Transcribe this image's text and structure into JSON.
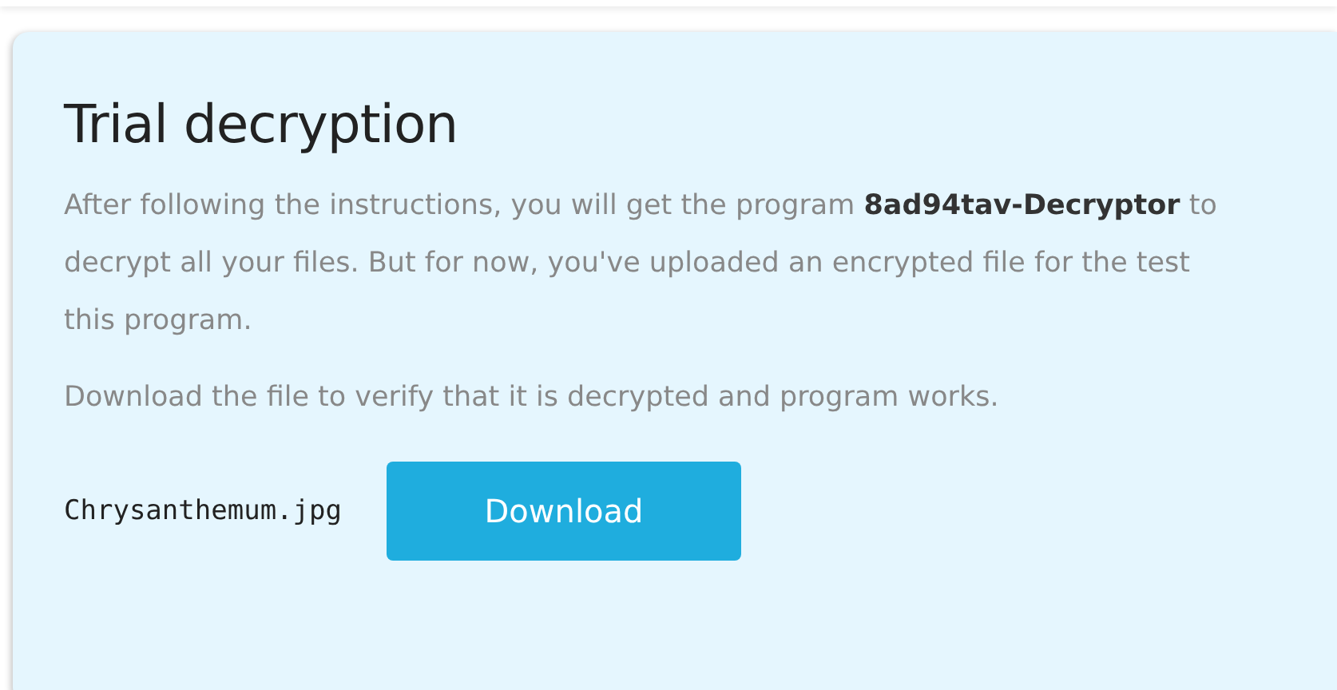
{
  "card": {
    "title": "Trial decryption",
    "paragraphs": [
      "After following the instructions, you will get the program **8ad94tav-Decryptor** to decrypt all your files. But for now, you've uploaded an encrypted file for the test this program.",
      "Download the file to verify that it is decrypted and program works."
    ],
    "file_name": "Chrysanthemum.jpg",
    "button": "Download"
  }
}
